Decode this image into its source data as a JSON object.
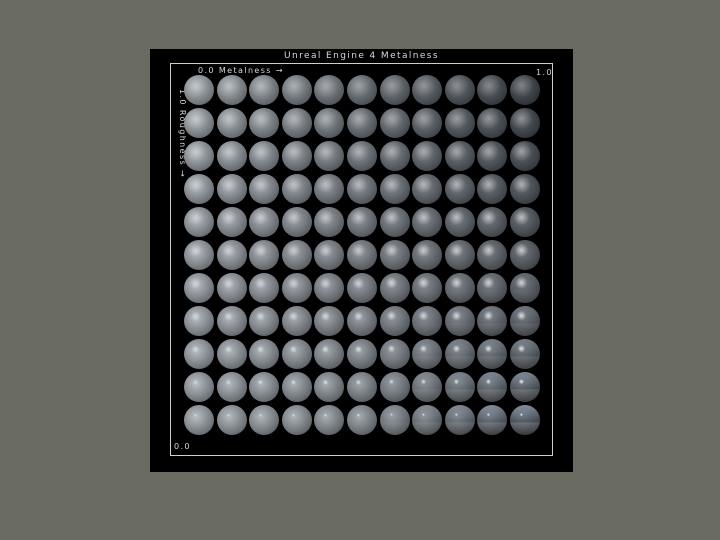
{
  "figure": {
    "title": "Unreal Engine 4 Metalness",
    "x_axis_label": "0.0 Metalness →",
    "x_axis_max": "1.0",
    "y_axis_label": "1.0 Roughness →",
    "y_axis_min": "0.0"
  },
  "grid": {
    "columns": 11,
    "rows": 11,
    "metalness_values": [
      0.0,
      0.1,
      0.2,
      0.3,
      0.4,
      0.5,
      0.6,
      0.7,
      0.8,
      0.9,
      1.0
    ],
    "roughness_values": [
      1.0,
      0.9,
      0.8,
      0.7,
      0.6,
      0.5,
      0.4,
      0.3,
      0.2,
      0.1,
      0.0
    ]
  },
  "colors": {
    "page_background": "#6a6b60",
    "figure_background": "#000000",
    "frame": "#cfcfcf",
    "label_text": "#d8d8d8"
  }
}
